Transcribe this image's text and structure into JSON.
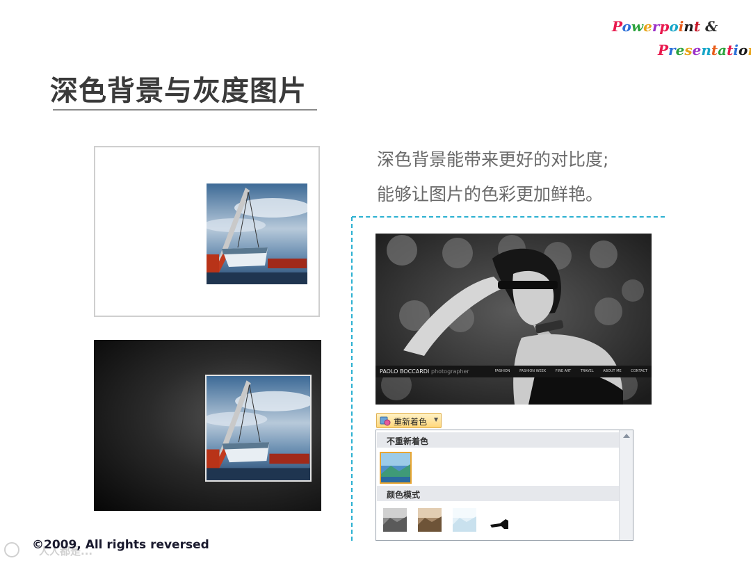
{
  "logo": {
    "line1": "Powerpoint &",
    "line2": "Presentation",
    "line1_colors": [
      "#e8194d",
      "#2a6fd8",
      "#2aa23c",
      "#e8a41a",
      "#9b2fc8",
      "#e8194d",
      "#17a6c8",
      "#e85c19",
      "#1a1a1a",
      "#c8192a",
      "#2a2a2a",
      "#1a1a1a"
    ],
    "line2_colors": [
      "#e8194d",
      "#2a6fd8",
      "#2aa23c",
      "#e8a41a",
      "#9b2fc8",
      "#17a6c8",
      "#e85c19",
      "#2aa23c",
      "#e8194d",
      "#2a6fd8",
      "#1a1a1a",
      "#e8a41a"
    ]
  },
  "slide": {
    "title": "深色背景与灰度图片",
    "description": [
      "深色背景能带来更好的对比度;",
      "能够让图片的色彩更加鲜艳。"
    ],
    "copyright": "©2009, All rights reversed",
    "watermark": "人人都是..."
  },
  "photo": {
    "name": "PAOLO BOCCARDI",
    "role": "photographer",
    "nav_items": [
      "FASHION",
      "FASHION WEEK",
      "FINE ART",
      "TRAVEL",
      "ABOUT ME",
      "CONTACT"
    ]
  },
  "recolor": {
    "button_label": "重新着色",
    "no_recolor_label": "不重新着色",
    "color_modes_label": "颜色模式",
    "color_mode_thumbs": [
      "grayscale",
      "sepia",
      "washout",
      "black-and-white"
    ]
  },
  "colors": {
    "accent_dash": "#2bb0d1",
    "title_text": "#3a3a3a",
    "body_text": "#6a6a6a",
    "selection": "#e8a530"
  }
}
